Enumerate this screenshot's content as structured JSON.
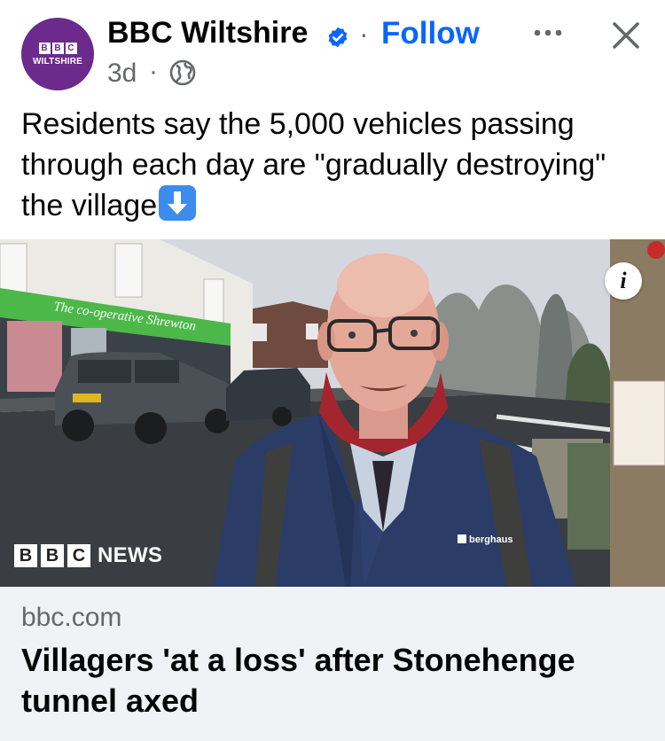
{
  "post": {
    "avatar": {
      "blocks": [
        "B",
        "B",
        "C"
      ],
      "subtitle": "WILTSHIRE"
    },
    "page_name": "BBC Wiltshire",
    "separator": "·",
    "follow_label": "Follow",
    "timestamp": "3d",
    "timestamp_separator": "·",
    "caption": "Residents say the 5,000 vehicles passing through each day are \"gradually destroying\" the village",
    "caption_emoji": "down-arrow-emoji"
  },
  "photo": {
    "watermark_blocks": [
      "B",
      "B",
      "C"
    ],
    "watermark_text": "NEWS",
    "info_label": "i",
    "jacket_brand": "berghaus"
  },
  "link_preview": {
    "domain": "bbc.com",
    "title": "Villagers 'at a loss' after Stonehenge tunnel axed"
  },
  "colors": {
    "avatar_bg": "#6b2a8c",
    "follow_blue": "#0866ff",
    "verified_blue": "#0866ff",
    "link_box_bg": "#f0f2f5",
    "secondary_text": "#65676b"
  }
}
